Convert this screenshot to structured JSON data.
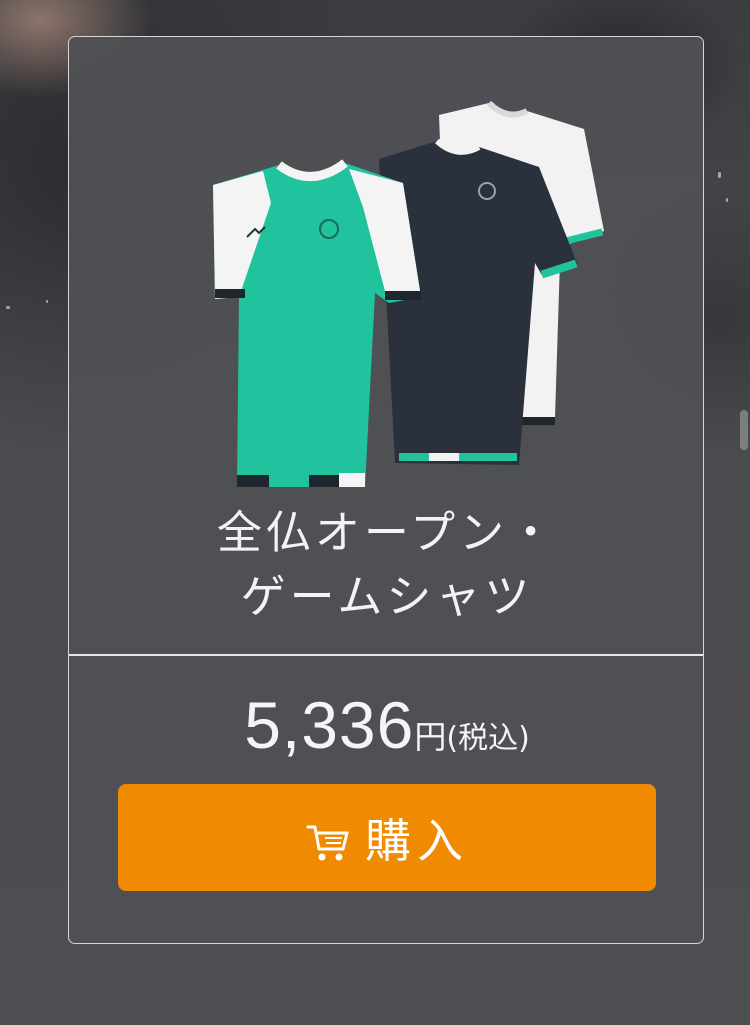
{
  "product": {
    "title_line1": "全仏オープン・",
    "title_line2": "ゲームシャツ",
    "image_alt": "shirts-image",
    "price": {
      "amount": "5,336",
      "unit": "円",
      "tax_note": "(税込)"
    }
  },
  "buy_button": {
    "label": "購入",
    "icon": "cart-icon"
  },
  "colors": {
    "card_border": "#d6d6d6",
    "button": "#f08a00",
    "shirt_green": "#21c29e",
    "shirt_navy": "#2a313d",
    "shirt_white": "#f2f2f2"
  }
}
